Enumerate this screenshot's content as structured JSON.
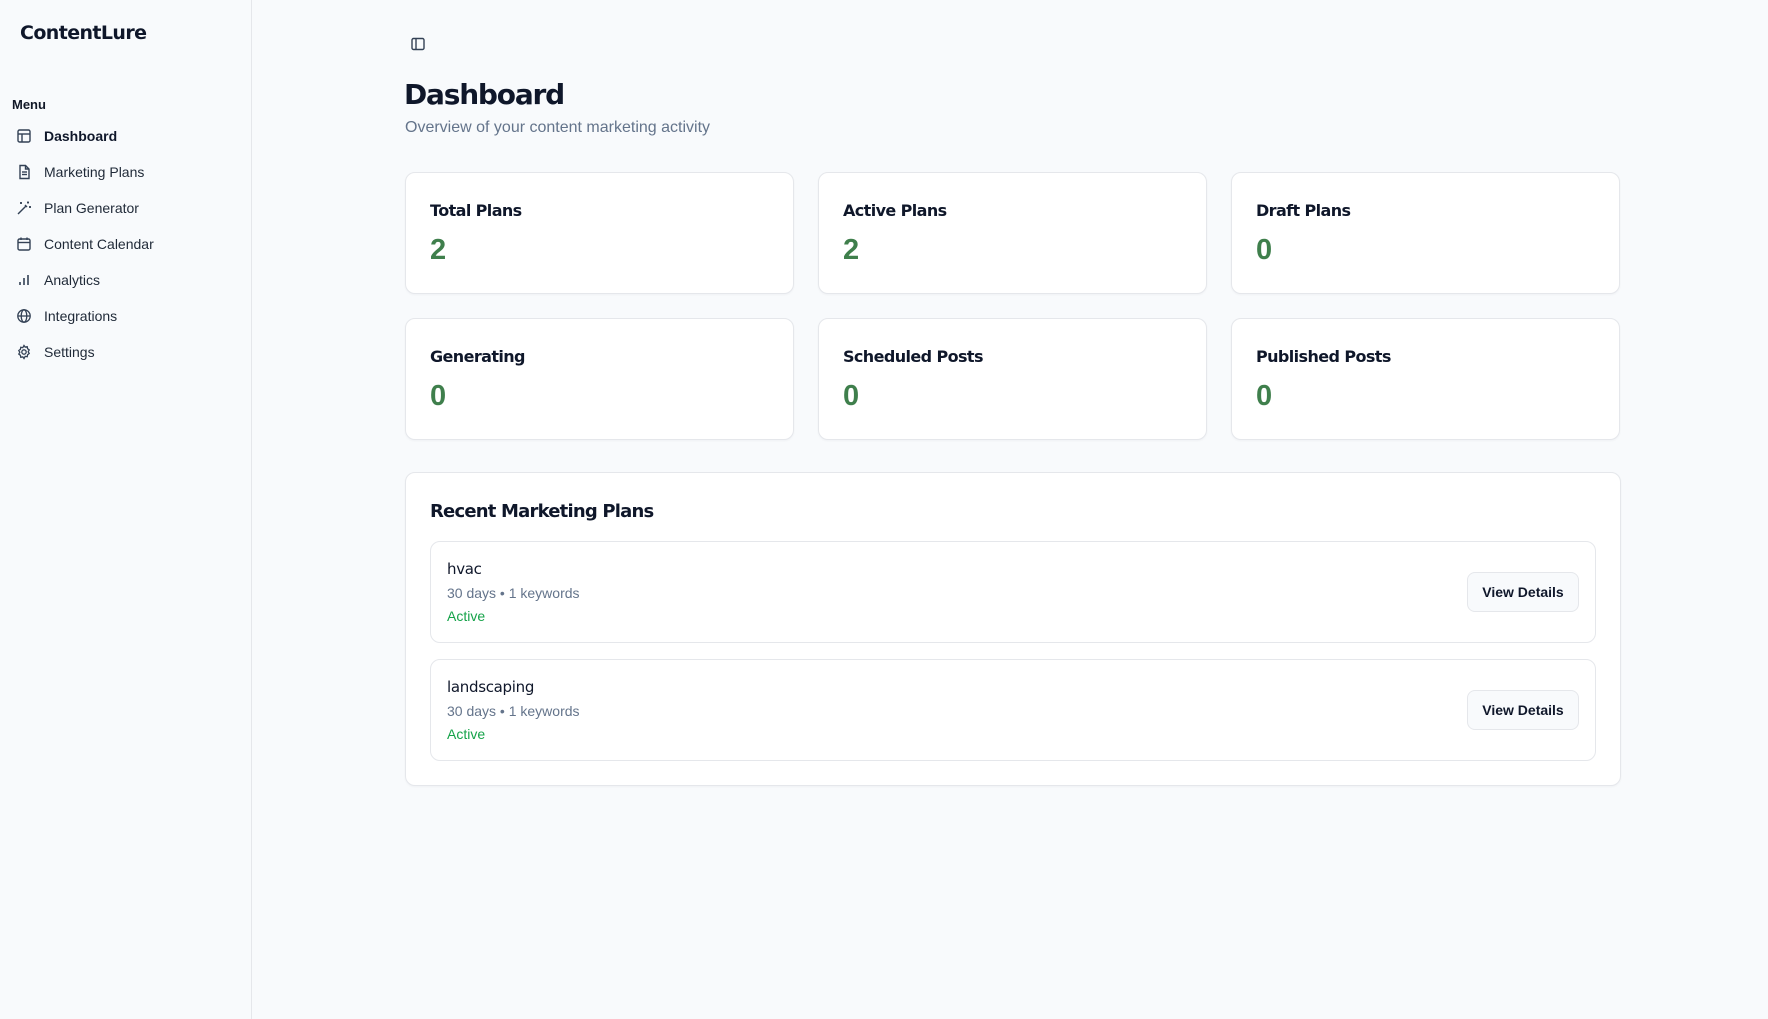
{
  "brand": {
    "name": "ContentLure"
  },
  "sidebar": {
    "menu_label": "Menu",
    "items": [
      {
        "label": "Dashboard",
        "icon": "dashboard-icon",
        "active": true
      },
      {
        "label": "Marketing Plans",
        "icon": "file-text-icon"
      },
      {
        "label": "Plan Generator",
        "icon": "magic-wand-icon"
      },
      {
        "label": "Content Calendar",
        "icon": "calendar-icon"
      },
      {
        "label": "Analytics",
        "icon": "bar-chart-icon"
      },
      {
        "label": "Integrations",
        "icon": "globe-icon"
      },
      {
        "label": "Settings",
        "icon": "gear-icon"
      }
    ]
  },
  "header": {
    "toggle_icon": "sidebar-toggle-icon",
    "title": "Dashboard",
    "subtitle": "Overview of your content marketing activity"
  },
  "stats": [
    {
      "title": "Total Plans",
      "value": "2"
    },
    {
      "title": "Active Plans",
      "value": "2"
    },
    {
      "title": "Draft Plans",
      "value": "0"
    },
    {
      "title": "Generating",
      "value": "0"
    },
    {
      "title": "Scheduled Posts",
      "value": "0"
    },
    {
      "title": "Published Posts",
      "value": "0"
    }
  ],
  "recent": {
    "title": "Recent Marketing Plans",
    "plans": [
      {
        "name": "hvac",
        "meta": "30 days • 1 keywords",
        "status": "Active",
        "button": "View Details"
      },
      {
        "name": "landscaping",
        "meta": "30 days • 1 keywords",
        "status": "Active",
        "button": "View Details"
      }
    ]
  },
  "colors": {
    "accent_green": "#3f7f4c",
    "status_active": "#16a34a",
    "muted_text": "#64748b"
  }
}
